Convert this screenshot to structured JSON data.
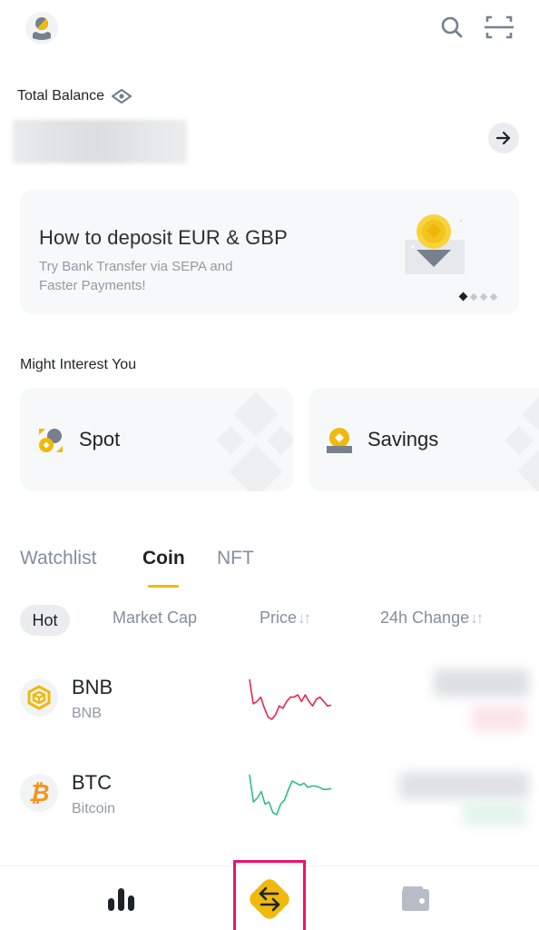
{
  "header": {
    "avatar_icon": "user-avatar-icon",
    "search_icon": "search-icon",
    "scan_icon": "scan-icon"
  },
  "balance": {
    "label": "Total Balance",
    "visibility_icon": "eye-icon",
    "value_hidden": true,
    "arrow_icon": "arrow-right-icon"
  },
  "banner": {
    "title": "How to deposit EUR & GBP",
    "subtitle": "Try Bank Transfer via SEPA and Faster Payments!",
    "page_index": 1,
    "page_count": 4
  },
  "interest": {
    "title": "Might Interest You",
    "cards": [
      {
        "label": "Spot",
        "icon": "spot-icon"
      },
      {
        "label": "Savings",
        "icon": "savings-icon"
      }
    ]
  },
  "market_tabs": {
    "items": [
      {
        "label": "Watchlist",
        "active": false
      },
      {
        "label": "Coin",
        "active": true
      },
      {
        "label": "NFT",
        "active": false
      }
    ]
  },
  "filters": {
    "items": [
      {
        "label": "Hot",
        "active": true
      },
      {
        "label": "Market Cap",
        "active": false
      },
      {
        "label": "Price",
        "sort": "↓↑",
        "active": false
      },
      {
        "label": "24h Change",
        "sort": "↓↑",
        "active": false
      }
    ]
  },
  "coins": [
    {
      "symbol": "BNB",
      "name": "BNB",
      "trend": "down",
      "color": "#e0294a",
      "spark": [
        10,
        4.5,
        5,
        6,
        3.5,
        1.5,
        1,
        2,
        4,
        3.5,
        5,
        6,
        6,
        6.5,
        5,
        6.5,
        5,
        4,
        5.5,
        6,
        5,
        4,
        4.2
      ]
    },
    {
      "symbol": "BTC",
      "name": "Bitcoin",
      "trend": "up",
      "color": "#2ebd85",
      "spark": [
        10,
        3.5,
        4.5,
        6,
        3,
        3.5,
        1,
        0.5,
        3,
        4,
        6.5,
        8.5,
        8,
        7.5,
        8,
        7,
        7.3,
        7.3,
        7,
        6.5,
        6.5,
        6.7
      ]
    }
  ],
  "bottom_nav": {
    "items": [
      {
        "name": "Markets",
        "icon": "markets-icon",
        "active": false
      },
      {
        "name": "Trade",
        "icon": "trade-icon",
        "active": true,
        "highlighted": true
      },
      {
        "name": "Wallets",
        "icon": "wallet-icon",
        "active": false
      }
    ]
  },
  "colors": {
    "brand_yellow": "#f0b90b",
    "text_primary": "#1e2329",
    "text_secondary": "#848e9c",
    "down_red": "#e0294a",
    "up_green": "#2ebd85",
    "highlight_pink": "#f0116b"
  }
}
